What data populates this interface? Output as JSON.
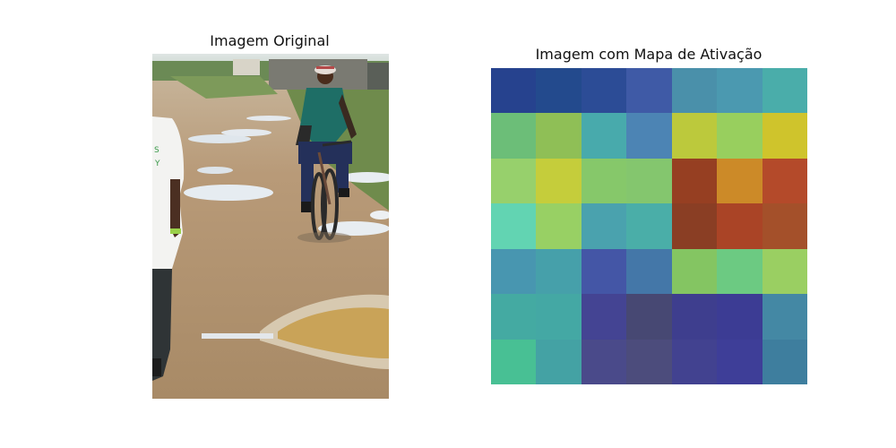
{
  "panels": {
    "left_title": "Imagem Original",
    "right_title": "Imagem com Mapa de Ativação"
  },
  "photo": {
    "subject": "Man riding a bicycle on a muddy dirt road with puddles; person in white shirt on left edge"
  },
  "chart_data": {
    "type": "heatmap",
    "title": "Imagem com Mapa de Ativação",
    "rows": 7,
    "cols": 7,
    "colors": [
      [
        "#26428e",
        "#234a8d",
        "#2c4c96",
        "#3f5aa6",
        "#4a90aa",
        "#4b99b0",
        "#4aadaa"
      ],
      [
        "#6cbe78",
        "#8fbf56",
        "#48aaac",
        "#4c84b4",
        "#bcc93c",
        "#98cf5e",
        "#cfc42c"
      ],
      [
        "#97d06c",
        "#c5cd3b",
        "#86c86a",
        "#84c66e",
        "#963f22",
        "#cc8a28",
        "#b44a2a"
      ],
      [
        "#62d4b2",
        "#98d064",
        "#4aa2ae",
        "#4aaea8",
        "#8a3e24",
        "#aa4426",
        "#a4502a"
      ],
      [
        "#4896b0",
        "#46a0aa",
        "#4456a6",
        "#4477a8",
        "#84c562",
        "#6cca82",
        "#9acf62"
      ],
      [
        "#44aaa2",
        "#44a8a4",
        "#444493",
        "#474873",
        "#3e3e8e",
        "#3c3c94",
        "#4488a4"
      ],
      [
        "#48c094",
        "#44a2a4",
        "#4a4a8a",
        "#4c4c7c",
        "#424290",
        "#3e3e98",
        "#3e7e9e"
      ]
    ]
  }
}
